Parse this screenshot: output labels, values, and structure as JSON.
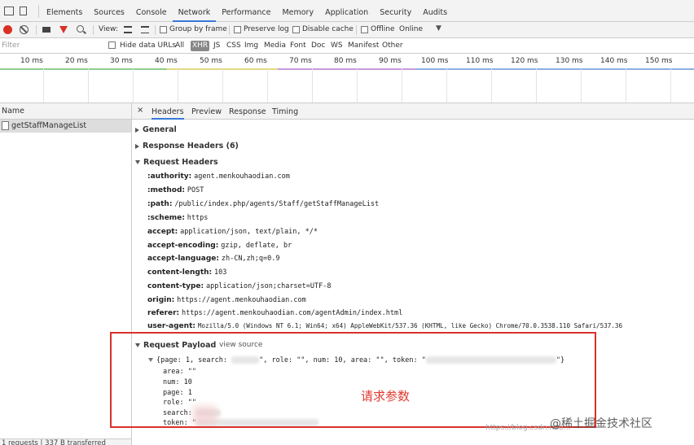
{
  "tabs": [
    "Elements",
    "Sources",
    "Console",
    "Network",
    "Performance",
    "Memory",
    "Application",
    "Security",
    "Audits"
  ],
  "active_tab": "Network",
  "toolbar": {
    "view_label": "View:",
    "group_by_frame": "Group by frame",
    "preserve_log": "Preserve log",
    "disable_cache": "Disable cache",
    "offline": "Offline",
    "throttle": "Online",
    "dropdown": "▼"
  },
  "filter": {
    "placeholder": "Filter",
    "hide_data_urls": "Hide data URLs",
    "types": [
      "All",
      "XHR",
      "JS",
      "CSS",
      "Img",
      "Media",
      "Font",
      "Doc",
      "WS",
      "Manifest",
      "Other"
    ],
    "selected_type": "XHR"
  },
  "timeline": {
    "ticks": [
      "10 ms",
      "20 ms",
      "30 ms",
      "40 ms",
      "50 ms",
      "60 ms",
      "70 ms",
      "80 ms",
      "90 ms",
      "100 ms",
      "110 ms",
      "120 ms",
      "130 ms",
      "140 ms",
      "150 ms"
    ]
  },
  "request_list": {
    "header": "Name",
    "items": [
      "getStaffManageList"
    ],
    "footer": "1 requests | 337 B transferred"
  },
  "detail": {
    "close": "×",
    "tabs": [
      "Headers",
      "Preview",
      "Response",
      "Timing"
    ],
    "active_tab": "Headers",
    "general": "General",
    "response_headers": "Response Headers (6)",
    "request_headers": "Request Headers",
    "headers": [
      {
        "k": ":authority:",
        "v": "agent.menkouhaodian.com"
      },
      {
        "k": ":method:",
        "v": "POST"
      },
      {
        "k": ":path:",
        "v": "/public/index.php/agents/Staff/getStaffManageList"
      },
      {
        "k": ":scheme:",
        "v": "https"
      },
      {
        "k": "accept:",
        "v": "application/json, text/plain, */*"
      },
      {
        "k": "accept-encoding:",
        "v": "gzip, deflate, br"
      },
      {
        "k": "accept-language:",
        "v": "zh-CN,zh;q=0.9"
      },
      {
        "k": "content-length:",
        "v": "103"
      },
      {
        "k": "content-type:",
        "v": "application/json;charset=UTF-8"
      },
      {
        "k": "origin:",
        "v": "https://agent.menkouhaodian.com"
      },
      {
        "k": "referer:",
        "v": "https://agent.menkouhaodian.com/agentAdmin/index.html"
      },
      {
        "k": "user-agent:",
        "v": "Mozilla/5.0 (Windows NT 6.1; Win64; x64) AppleWebKit/537.36 (KHTML, like Gecko) Chrome/70.0.3538.110 Safari/537.36"
      }
    ],
    "request_payload": "Request Payload",
    "view_source": "view source",
    "payload_summary_a": "{page: 1, search: ",
    "payload_summary_b": "\", role: \"\", num: 10, area: \"\", token: \"",
    "payload_summary_c": "\"}",
    "payload_fields": [
      {
        "k": "area:",
        "v": "\"\""
      },
      {
        "k": "num:",
        "v": "10"
      },
      {
        "k": "page:",
        "v": "1"
      },
      {
        "k": "role:",
        "v": "\"\""
      },
      {
        "k": "search:",
        "v": ""
      },
      {
        "k": "token:",
        "v": "\""
      }
    ]
  },
  "annotation": "请求参数",
  "watermark": "@稀土掘金技术社区",
  "watermark_url": "https://blog.csdn.net/..."
}
